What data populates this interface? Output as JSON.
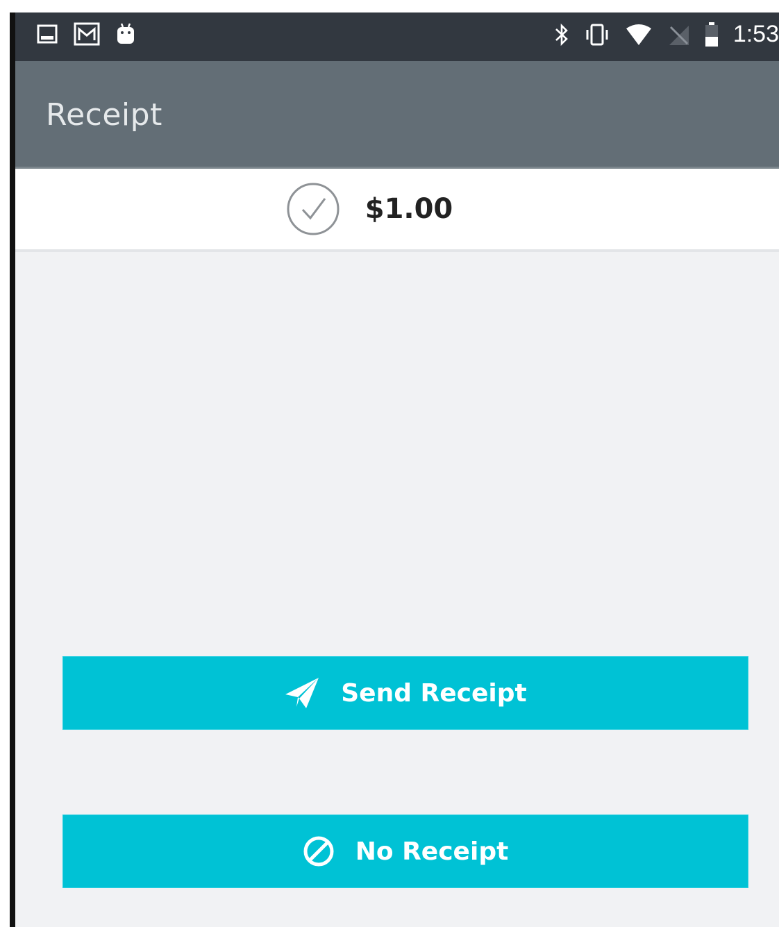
{
  "colors": {
    "status_bar": "#323840",
    "app_bar": "#636e76",
    "background": "#f1f2f4",
    "button": "#00c2d5",
    "button_text": "#ffffff",
    "amount_text": "#222222"
  },
  "status_bar": {
    "left_icons": [
      "image-icon",
      "gmail-icon",
      "android-icon"
    ],
    "right_icons": [
      "bluetooth-icon",
      "vibrate-icon",
      "wifi-icon",
      "no-signal-icon",
      "battery-icon"
    ],
    "time": "1:53"
  },
  "app_bar": {
    "title": "Receipt"
  },
  "transaction": {
    "status_icon": "check-circle-icon",
    "amount": "$1.00"
  },
  "actions": {
    "send_receipt": {
      "label": "Send Receipt",
      "icon": "send-icon"
    },
    "no_receipt": {
      "label": "No Receipt",
      "icon": "block-icon"
    }
  }
}
